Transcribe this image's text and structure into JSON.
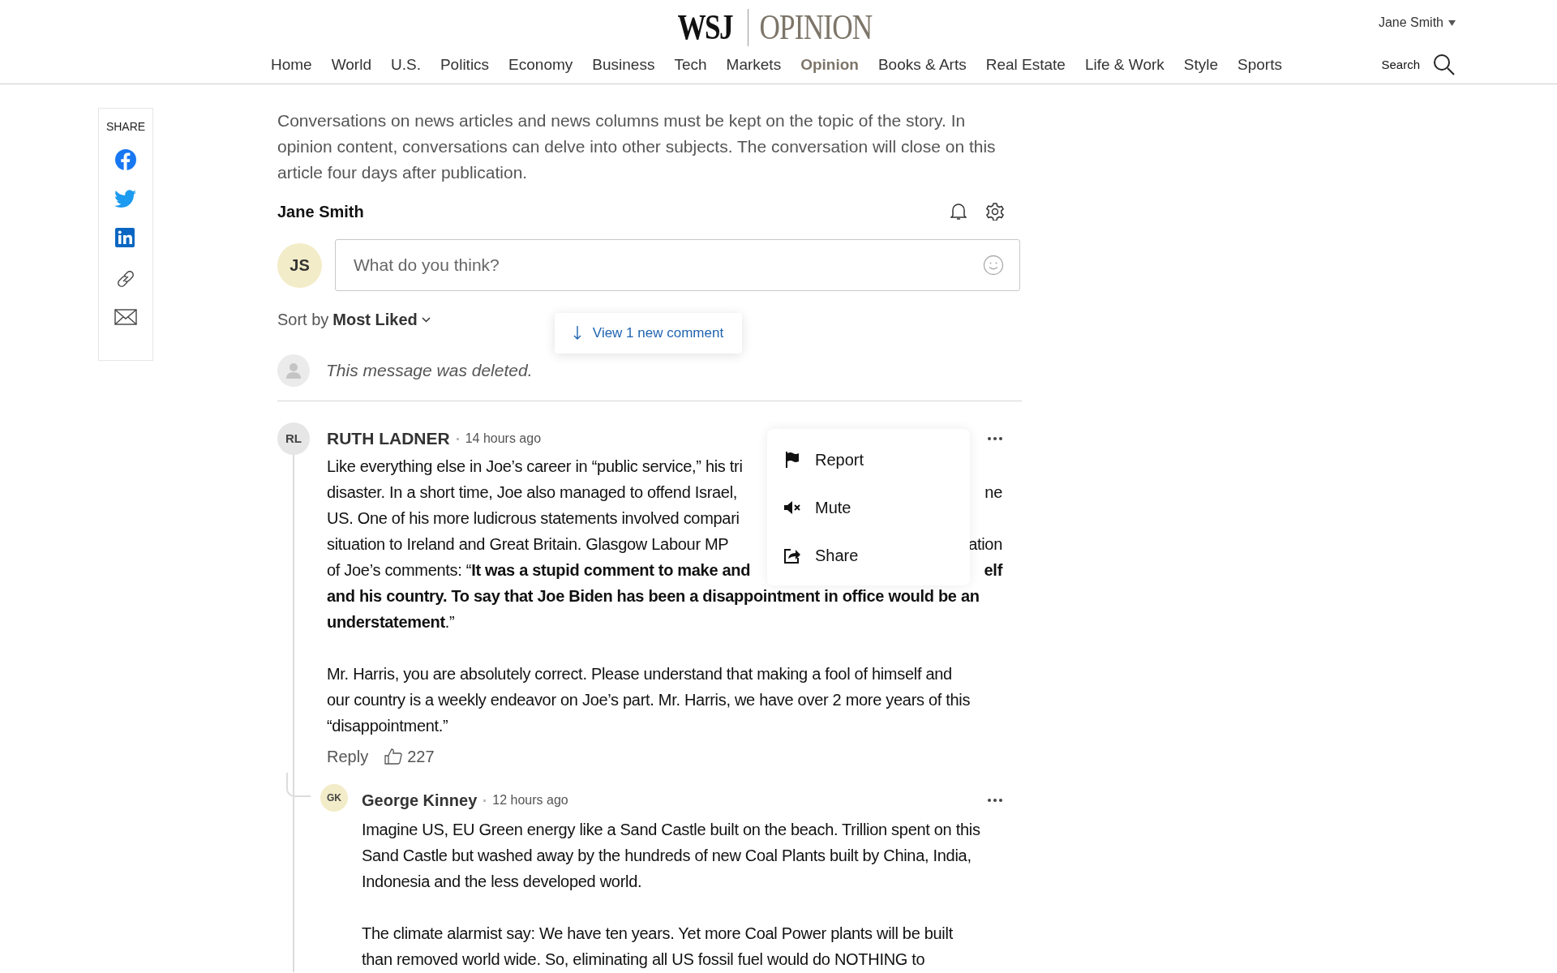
{
  "header": {
    "logo_mark": "WSJ",
    "logo_section": "OPINION",
    "user": "Jane Smith",
    "search": "Search"
  },
  "nav": [
    {
      "label": "Home",
      "selected": false
    },
    {
      "label": "World",
      "selected": false
    },
    {
      "label": "U.S.",
      "selected": false
    },
    {
      "label": "Politics",
      "selected": false
    },
    {
      "label": "Economy",
      "selected": false
    },
    {
      "label": "Business",
      "selected": false
    },
    {
      "label": "Tech",
      "selected": false
    },
    {
      "label": "Markets",
      "selected": false
    },
    {
      "label": "Opinion",
      "selected": true
    },
    {
      "label": "Books & Arts",
      "selected": false
    },
    {
      "label": "Real Estate",
      "selected": false
    },
    {
      "label": "Life & Work",
      "selected": false
    },
    {
      "label": "Style",
      "selected": false
    },
    {
      "label": "Sports",
      "selected": false
    }
  ],
  "share": {
    "title": "SHARE",
    "items": [
      {
        "kind": "facebook"
      },
      {
        "kind": "twitter"
      },
      {
        "kind": "linkedin"
      },
      {
        "kind": "link"
      },
      {
        "kind": "email"
      }
    ]
  },
  "intro": "Conversations on news articles and news columns must be kept on the topic of the story. In opinion content, conversations can delve into other subjects. The conversation will close on this article four days after publication.",
  "composer": {
    "user": "Jane Smith",
    "initials": "JS",
    "placeholder": "What do you think?"
  },
  "sort": {
    "label": "Sort by",
    "value": "Most Liked"
  },
  "new_comments": "View 1 new comment",
  "deleted": "This message was deleted.",
  "comments": [
    {
      "initials": "RL",
      "color": "#e6e6e6",
      "author": "RUTH LADNER",
      "time": "14 hours ago",
      "paragraphs": [
        [
          {
            "left": "Like everything else in Joe’s career in “public service,” his tri"
          },
          {
            "left": "disaster.  In a short time, Joe also managed to offend Israel,",
            "right": "ne"
          },
          {
            "left": "US.  One of his more ludicrous statements involved compari"
          },
          {
            "left": "situation to Ireland and Great Britain.   Glasgow Labour MP",
            "right": "ation"
          },
          {
            "left": "of Joe’s comments: “**It was a stupid comment to make and**",
            "right": "elf",
            "right_bold": true
          },
          {
            "left": "**and his country.  To say that Joe Biden has been a disappointment in office would be an**"
          },
          {
            "left": "**understatement**.”"
          }
        ],
        [
          {
            "left": "Mr. Harris, you are absolutely correct.  Please understand that making a fool of himself and"
          },
          {
            "left": "our country is a weekly endeavor on Joe’s part.  Mr. Harris, we have over 2 more years of this"
          },
          {
            "left": "“disappointment.”"
          }
        ]
      ],
      "menu": [
        {
          "kind": "report",
          "label": "Report"
        },
        {
          "kind": "mute",
          "label": "Mute"
        },
        {
          "kind": "share",
          "label": "Share"
        }
      ],
      "reply": "Reply",
      "likes": "227",
      "replies": [
        {
          "initials": "GK",
          "color": "#f3ecc8",
          "author": "George Kinney",
          "time": "12 hours ago",
          "paragraphs": [
            [
              {
                "left": "Imagine US, EU Green energy like a Sand Castle built on the beach. Trillion spent on this"
              },
              {
                "left": "Sand Castle but washed away by the hundreds of new Coal Plants built by China, India,"
              },
              {
                "left": "Indonesia and the less developed world."
              }
            ],
            [
              {
                "left": "The climate alarmist say: We have ten years. Yet more Coal Power plants will be built"
              },
              {
                "left": "than removed world wide. So, eliminating all US fossil fuel would do NOTHING to"
              }
            ]
          ]
        }
      ]
    }
  ]
}
